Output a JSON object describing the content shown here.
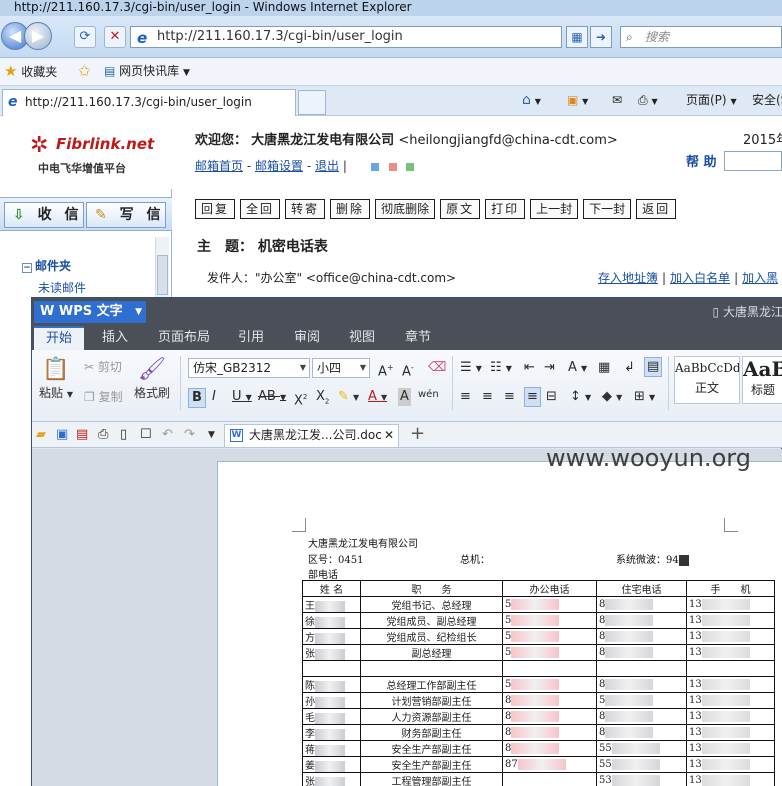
{
  "ie": {
    "window_title": "http://211.160.17.3/cgi-bin/user_login - Windows Internet Explorer",
    "address": "http://211.160.17.3/cgi-bin/user_login",
    "search_placeholder": "搜索",
    "favorites_label": "收藏夹",
    "quick_library_label": "网页快讯库",
    "tab_title": "http://211.160.17.3/cgi-bin/user_login",
    "cmd_page": "页面(P)",
    "cmd_safety": "安全(S"
  },
  "mail": {
    "brand": "Fibrlink.net",
    "brand_sub": "中电飞华增值平台",
    "welcome_label": "欢迎您：",
    "company": "大唐黑龙江发电有限公司",
    "email": "<heilongjiangfd@china-cdt.com>",
    "year_text": "2015年",
    "links": [
      "邮箱首页",
      "邮箱设置",
      "退出"
    ],
    "help": "帮 助",
    "receive": "收 信",
    "write": "写 信",
    "folder_title": "邮件夹",
    "folder_unread": "未读邮件",
    "toolbar": [
      "回复",
      "全回",
      "转寄",
      "删除",
      "彻底删除",
      "原文",
      "打印",
      "上一封",
      "下一封",
      "返回"
    ],
    "subject_label": "主　题：",
    "subject": "机密电话表",
    "sender_label": "发件人：",
    "sender": "\"办公室\" <office@china-cdt.com>",
    "addr_links": [
      "存入地址簿",
      "加入白名单",
      "加入黑"
    ],
    "accent": "#1a4fa0"
  },
  "wps": {
    "app_name": "WPS 文字",
    "doc_title": "大唐黑龙江",
    "menu": [
      "开始",
      "插入",
      "页面布局",
      "引用",
      "审阅",
      "视图",
      "章节"
    ],
    "ribbon": {
      "paste": "粘贴",
      "cut": "剪切",
      "copy": "复制",
      "format_painter": "格式刷",
      "font": "仿宋_GB2312",
      "size": "小四",
      "style_normal_sample": "AaBbCcDd",
      "style_normal": "正文",
      "style_heading_sample": "AaB",
      "style_heading": "标题"
    },
    "doc_tab": "大唐黑龙江发...公司.doc",
    "document": {
      "org": "大唐黑龙江发电有限公司",
      "area_code": "区号：0451",
      "switchboard": "总机：",
      "system_fax": "系统微波：94",
      "section": "部电话",
      "headers": [
        "姓 名",
        "职　　务",
        "办公电话",
        "住宅电话",
        "手　　机"
      ],
      "rows": [
        {
          "name": "王",
          "title": "党组书记、总经理",
          "office": "5",
          "home": "8",
          "mobile": "13"
        },
        {
          "name": "徐",
          "title": "党组成员、副总经理",
          "office": "5",
          "home": "8",
          "mobile": "13"
        },
        {
          "name": "方",
          "title": "党组成员、纪检组长",
          "office": "5",
          "home": "8",
          "mobile": "13"
        },
        {
          "name": "张",
          "title": "副总经理",
          "office": "5",
          "home": "8",
          "mobile": "13"
        },
        {
          "name": "",
          "title": "",
          "office": "",
          "home": "",
          "mobile": ""
        },
        {
          "name": "陈",
          "title": "总经理工作部副主任",
          "office": "5",
          "home": "8",
          "mobile": "13"
        },
        {
          "name": "孙",
          "title": "计划营销部副主任",
          "office": "8",
          "home": "5",
          "mobile": "13"
        },
        {
          "name": "毛",
          "title": "人力资源部副主任",
          "office": "8",
          "home": "8",
          "mobile": "13"
        },
        {
          "name": "李",
          "title": "财务部副主任",
          "office": "8",
          "home": "8",
          "mobile": "13"
        },
        {
          "name": "蒋",
          "title": "安全生产部副主任",
          "office": "8",
          "home": "55",
          "mobile": "13"
        },
        {
          "name": "姜",
          "title": "安全生产部副主任",
          "office": "87",
          "home": "55",
          "mobile": "13"
        },
        {
          "name": "张",
          "title": "工程管理部副主任",
          "office": "",
          "home": "53",
          "mobile": "13"
        }
      ]
    }
  },
  "watermark": "www.wooyun.org"
}
